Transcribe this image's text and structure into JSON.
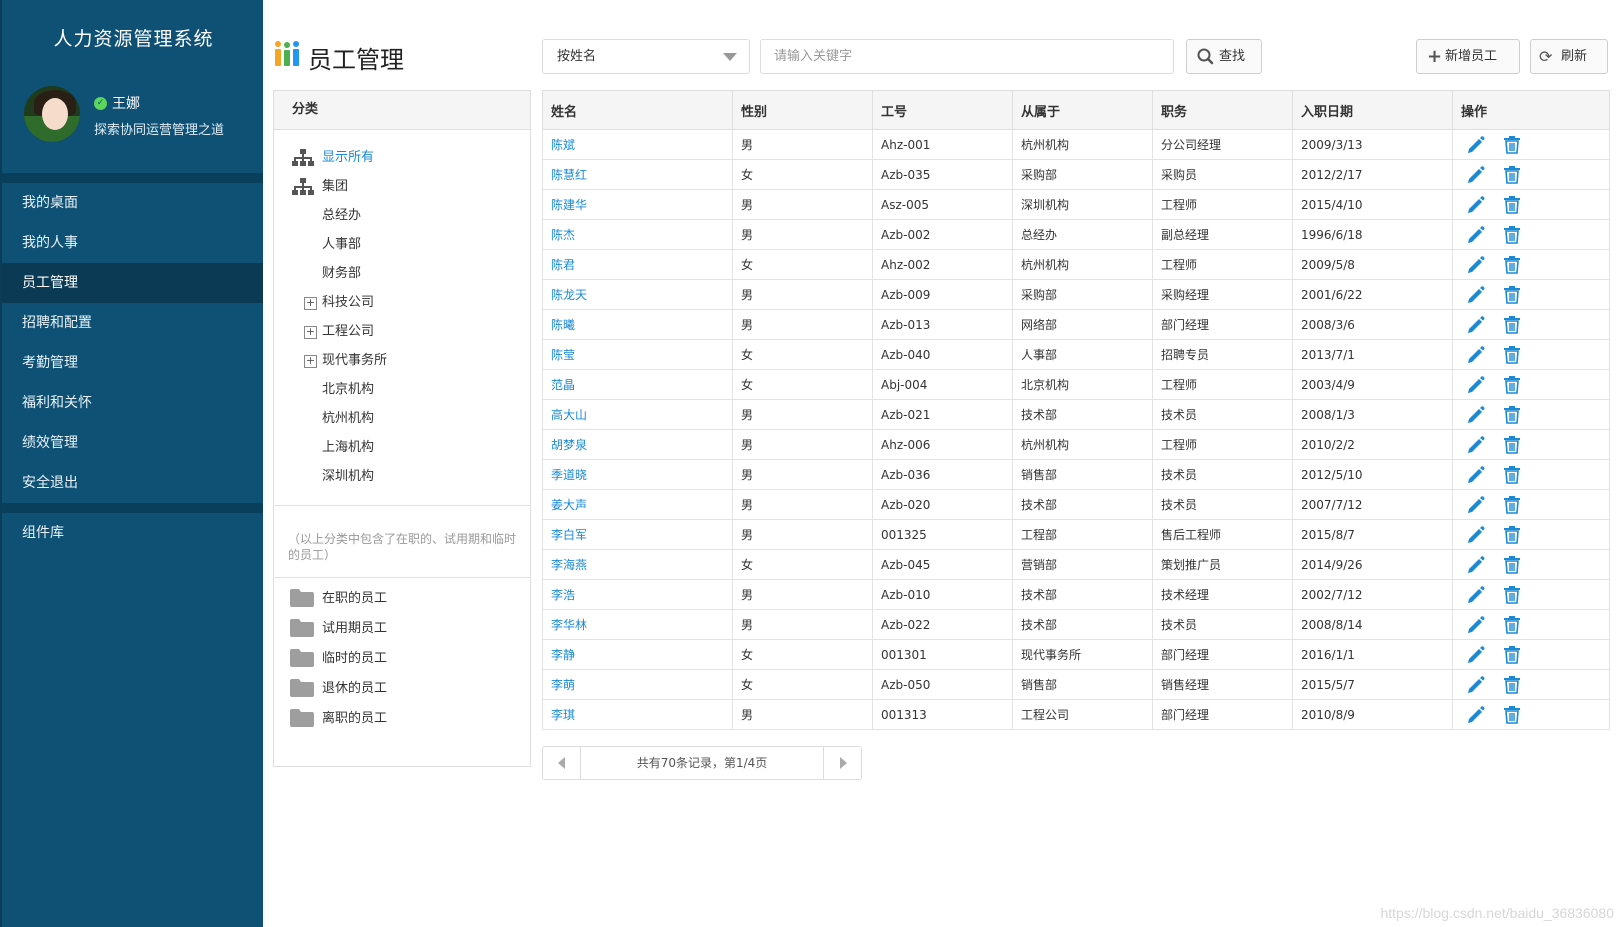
{
  "colors": {
    "sidebar_bg": "#0e5174",
    "sidebar_active": "#0b3a54",
    "link": "#1a8ad4",
    "icon_blue": "#1a8ad4",
    "online_green": "#5cd65c"
  },
  "sidebar": {
    "app_title": "人力资源管理系统",
    "user": {
      "name": "王娜",
      "motto": "探索协同运营管理之道",
      "status_icon": "check-circle-icon"
    },
    "nav": [
      {
        "label": "我的桌面",
        "active": false
      },
      {
        "label": "我的人事",
        "active": false
      },
      {
        "label": "员工管理",
        "active": true
      },
      {
        "label": "招聘和配置",
        "active": false
      },
      {
        "label": "考勤管理",
        "active": false
      },
      {
        "label": "福利和关怀",
        "active": false
      },
      {
        "label": "绩效管理",
        "active": false
      },
      {
        "label": "安全退出",
        "active": false
      }
    ],
    "nav_extra": {
      "label": "组件库"
    }
  },
  "header": {
    "title": "员工管理",
    "search_field_select": "按姓名",
    "search_placeholder": "请输入关键字",
    "search_button": "查找",
    "add_button": "新增员工",
    "refresh_button": "刷新"
  },
  "category": {
    "header": "分类",
    "tree": [
      {
        "label": "显示所有",
        "type": "org",
        "selected": true
      },
      {
        "label": "集团",
        "type": "org",
        "selected": false
      },
      {
        "label": "总经办",
        "type": "leaf"
      },
      {
        "label": "人事部",
        "type": "leaf"
      },
      {
        "label": "财务部",
        "type": "leaf"
      },
      {
        "label": "科技公司",
        "type": "expandable"
      },
      {
        "label": "工程公司",
        "type": "expandable"
      },
      {
        "label": "现代事务所",
        "type": "expandable"
      },
      {
        "label": "北京机构",
        "type": "leaf"
      },
      {
        "label": "杭州机构",
        "type": "leaf"
      },
      {
        "label": "上海机构",
        "type": "leaf"
      },
      {
        "label": "深圳机构",
        "type": "leaf"
      }
    ],
    "note": "（以上分类中包含了在职的、试用期和临时的员工）",
    "folders": [
      "在职的员工",
      "试用期员工",
      "临时的员工",
      "退休的员工",
      "离职的员工"
    ]
  },
  "table": {
    "columns": [
      "姓名",
      "性别",
      "工号",
      "从属于",
      "职务",
      "入职日期",
      "操作"
    ],
    "rows": [
      [
        "陈斌",
        "男",
        "Ahz-001",
        "杭州机构",
        "分公司经理",
        "2009/3/13"
      ],
      [
        "陈慧红",
        "女",
        "Azb-035",
        "采购部",
        "采购员",
        "2012/2/17"
      ],
      [
        "陈建华",
        "男",
        "Asz-005",
        "深圳机构",
        "工程师",
        "2015/4/10"
      ],
      [
        "陈杰",
        "男",
        "Azb-002",
        "总经办",
        "副总经理",
        "1996/6/18"
      ],
      [
        "陈君",
        "女",
        "Ahz-002",
        "杭州机构",
        "工程师",
        "2009/5/8"
      ],
      [
        "陈龙天",
        "男",
        "Azb-009",
        "采购部",
        "采购经理",
        "2001/6/22"
      ],
      [
        "陈曦",
        "男",
        "Azb-013",
        "网络部",
        "部门经理",
        "2008/3/6"
      ],
      [
        "陈莹",
        "女",
        "Azb-040",
        "人事部",
        "招聘专员",
        "2013/7/1"
      ],
      [
        "范晶",
        "女",
        "Abj-004",
        "北京机构",
        "工程师",
        "2003/4/9"
      ],
      [
        "高大山",
        "男",
        "Azb-021",
        "技术部",
        "技术员",
        "2008/1/3"
      ],
      [
        "胡梦泉",
        "男",
        "Ahz-006",
        "杭州机构",
        "工程师",
        "2010/2/2"
      ],
      [
        "季道晓",
        "男",
        "Azb-036",
        "销售部",
        "技术员",
        "2012/5/10"
      ],
      [
        "姜大声",
        "男",
        "Azb-020",
        "技术部",
        "技术员",
        "2007/7/12"
      ],
      [
        "李白军",
        "男",
        "001325",
        "工程部",
        "售后工程师",
        "2015/8/7"
      ],
      [
        "李海燕",
        "女",
        "Azb-045",
        "营销部",
        "策划推广员",
        "2014/9/26"
      ],
      [
        "李浩",
        "男",
        "Azb-010",
        "技术部",
        "技术经理",
        "2002/7/12"
      ],
      [
        "李华林",
        "男",
        "Azb-022",
        "技术部",
        "技术员",
        "2008/8/14"
      ],
      [
        "李静",
        "女",
        "001301",
        "现代事务所",
        "部门经理",
        "2016/1/1"
      ],
      [
        "李萌",
        "女",
        "Azb-050",
        "销售部",
        "销售经理",
        "2015/5/7"
      ],
      [
        "李琪",
        "男",
        "001313",
        "工程公司",
        "部门经理",
        "2010/8/9"
      ]
    ]
  },
  "pager": {
    "info": "共有70条记录，第1/4页"
  },
  "watermark": "https://blog.csdn.net/baidu_36836080"
}
